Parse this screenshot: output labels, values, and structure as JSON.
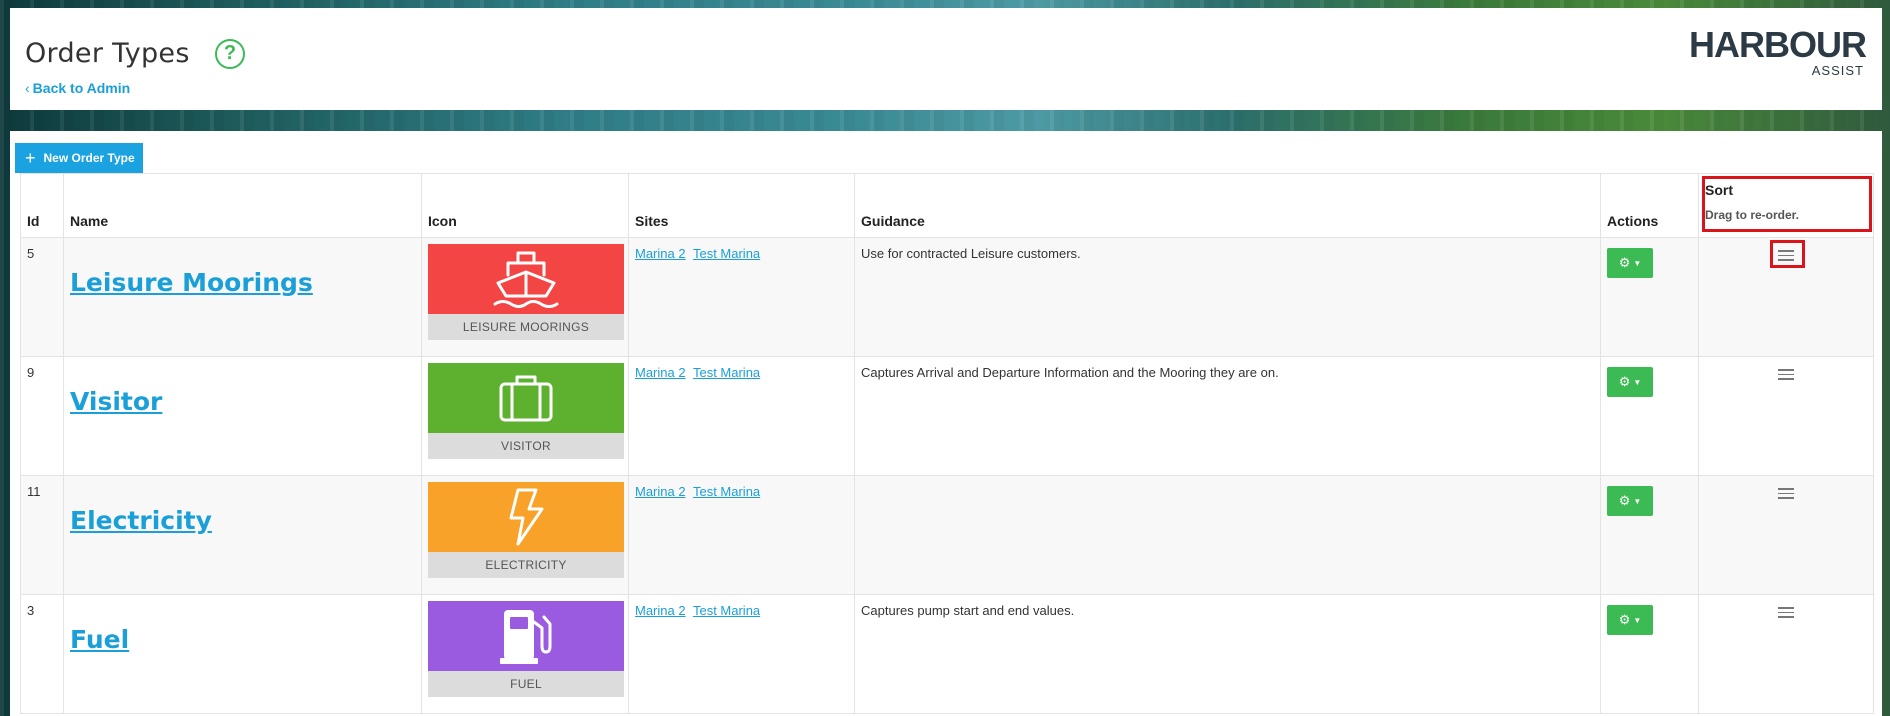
{
  "header": {
    "title": "Order Types",
    "help_icon": "question-circle-icon",
    "back_label": "Back to Admin",
    "logo": {
      "main": "HARBOUR",
      "sub": "ASSIST"
    }
  },
  "toolbar": {
    "new_label": "New Order Type"
  },
  "table": {
    "columns": {
      "id": "Id",
      "name": "Name",
      "icon": "Icon",
      "sites": "Sites",
      "guidance": "Guidance",
      "actions": "Actions",
      "sort": "Sort",
      "sort_hint": "Drag to re-order."
    },
    "rows": [
      {
        "id": "5",
        "name": "Leisure Moorings",
        "icon_name": "ship-icon",
        "icon_color": "#f44545",
        "icon_label": "LEISURE MOORINGS",
        "sites": [
          "Marina 2",
          "Test Marina"
        ],
        "guidance": "Use for contracted Leisure customers."
      },
      {
        "id": "9",
        "name": "Visitor",
        "icon_name": "suitcase-icon",
        "icon_color": "#5db12f",
        "icon_label": "VISITOR",
        "sites": [
          "Marina 2",
          "Test Marina"
        ],
        "guidance": "Captures Arrival and Departure Information and the Mooring they are on."
      },
      {
        "id": "11",
        "name": "Electricity",
        "icon_name": "lightning-bolt-icon",
        "icon_color": "#f8a229",
        "icon_label": "ELECTRICITY",
        "sites": [
          "Marina 2",
          "Test Marina"
        ],
        "guidance": ""
      },
      {
        "id": "3",
        "name": "Fuel",
        "icon_name": "fuel-pump-icon",
        "icon_color": "#9b5be0",
        "icon_label": "FUEL",
        "sites": [
          "Marina 2",
          "Test Marina"
        ],
        "guidance": "Captures pump start and end values."
      }
    ]
  },
  "colors": {
    "primary_blue": "#1aa3e0",
    "action_green": "#3cba54",
    "highlight_red": "#d9141b"
  }
}
